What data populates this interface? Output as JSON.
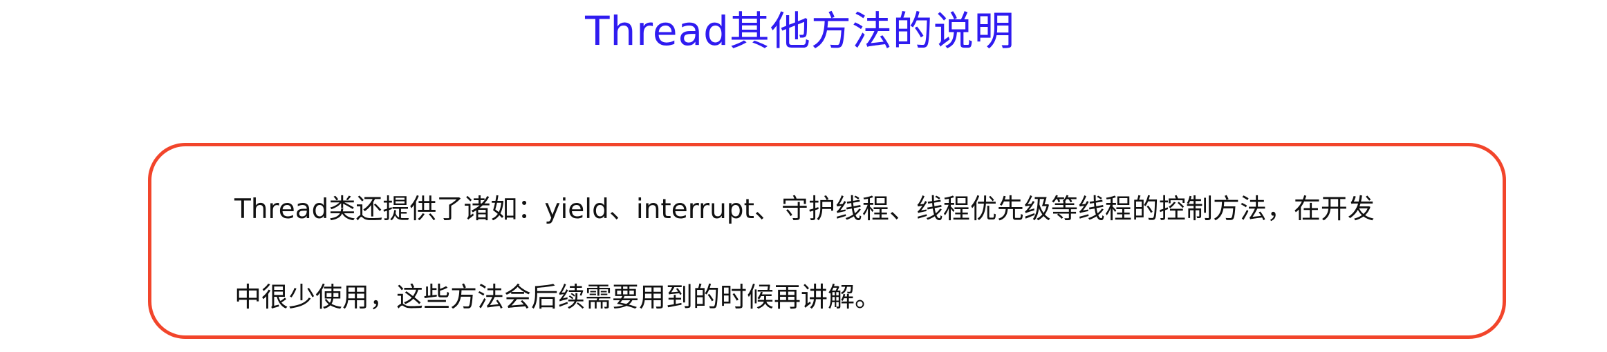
{
  "document": {
    "title": "Thread其他方法的说明",
    "note": {
      "line1": "Thread类还提供了诸如：yield、interrupt、守护线程、线程优先级等线程的控制方法，在开发",
      "line2": "中很少使用，这些方法会后续需要用到的时候再讲解。"
    },
    "colors": {
      "title": "#2f1bf0",
      "border": "#f2452b",
      "text": "#111111",
      "background": "#ffffff"
    }
  }
}
